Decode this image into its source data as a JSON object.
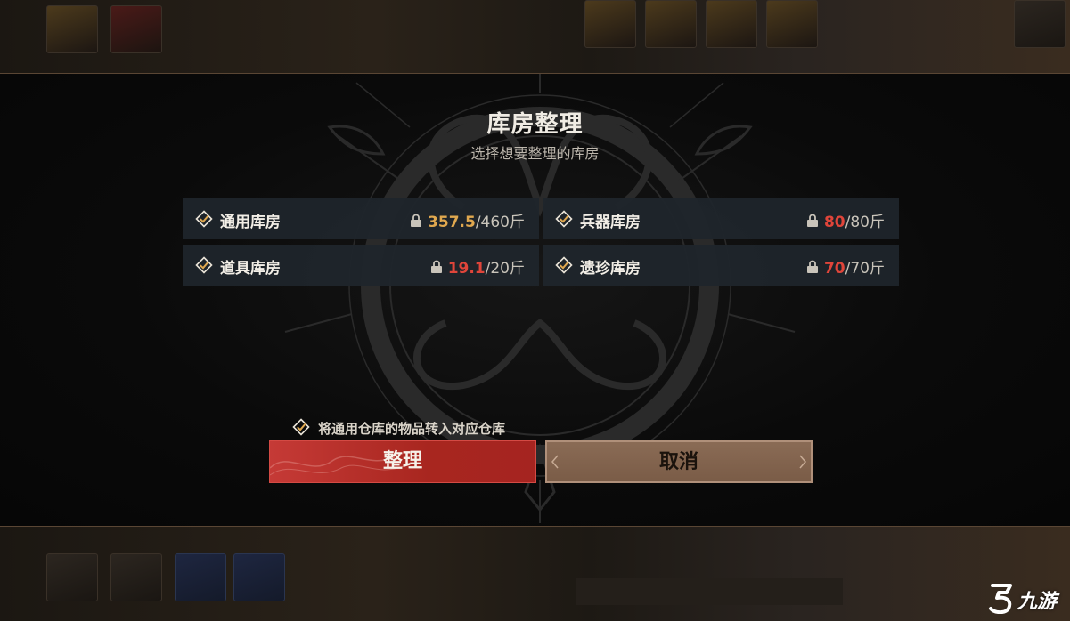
{
  "dialog": {
    "title": "库房整理",
    "subtitle": "选择想要整理的库房"
  },
  "warehouses": [
    {
      "name": "通用库房",
      "checked": true,
      "current": "357.5",
      "max": "/460斤",
      "status": "normal"
    },
    {
      "name": "兵器库房",
      "checked": true,
      "current": "80",
      "max": "/80斤",
      "status": "full"
    },
    {
      "name": "道具库房",
      "checked": true,
      "current": "19.1",
      "max": "/20斤",
      "status": "near-full"
    },
    {
      "name": "遗珍库房",
      "checked": true,
      "current": "70",
      "max": "/70斤",
      "status": "full"
    }
  ],
  "transfer_option": {
    "label": "将通用仓库的物品转入对应仓库",
    "checked": true
  },
  "buttons": {
    "confirm": "整理",
    "cancel": "取消"
  },
  "colors": {
    "capacity_normal": "#e0a84f",
    "capacity_full": "#e0453a",
    "confirm_button": "#a8261f",
    "cancel_button": "#7a5c47"
  },
  "icons": {
    "warehouse_check": "checked-diamond-icon",
    "capacity": "weight-lock-icon"
  },
  "watermark": {
    "text": "九游"
  }
}
